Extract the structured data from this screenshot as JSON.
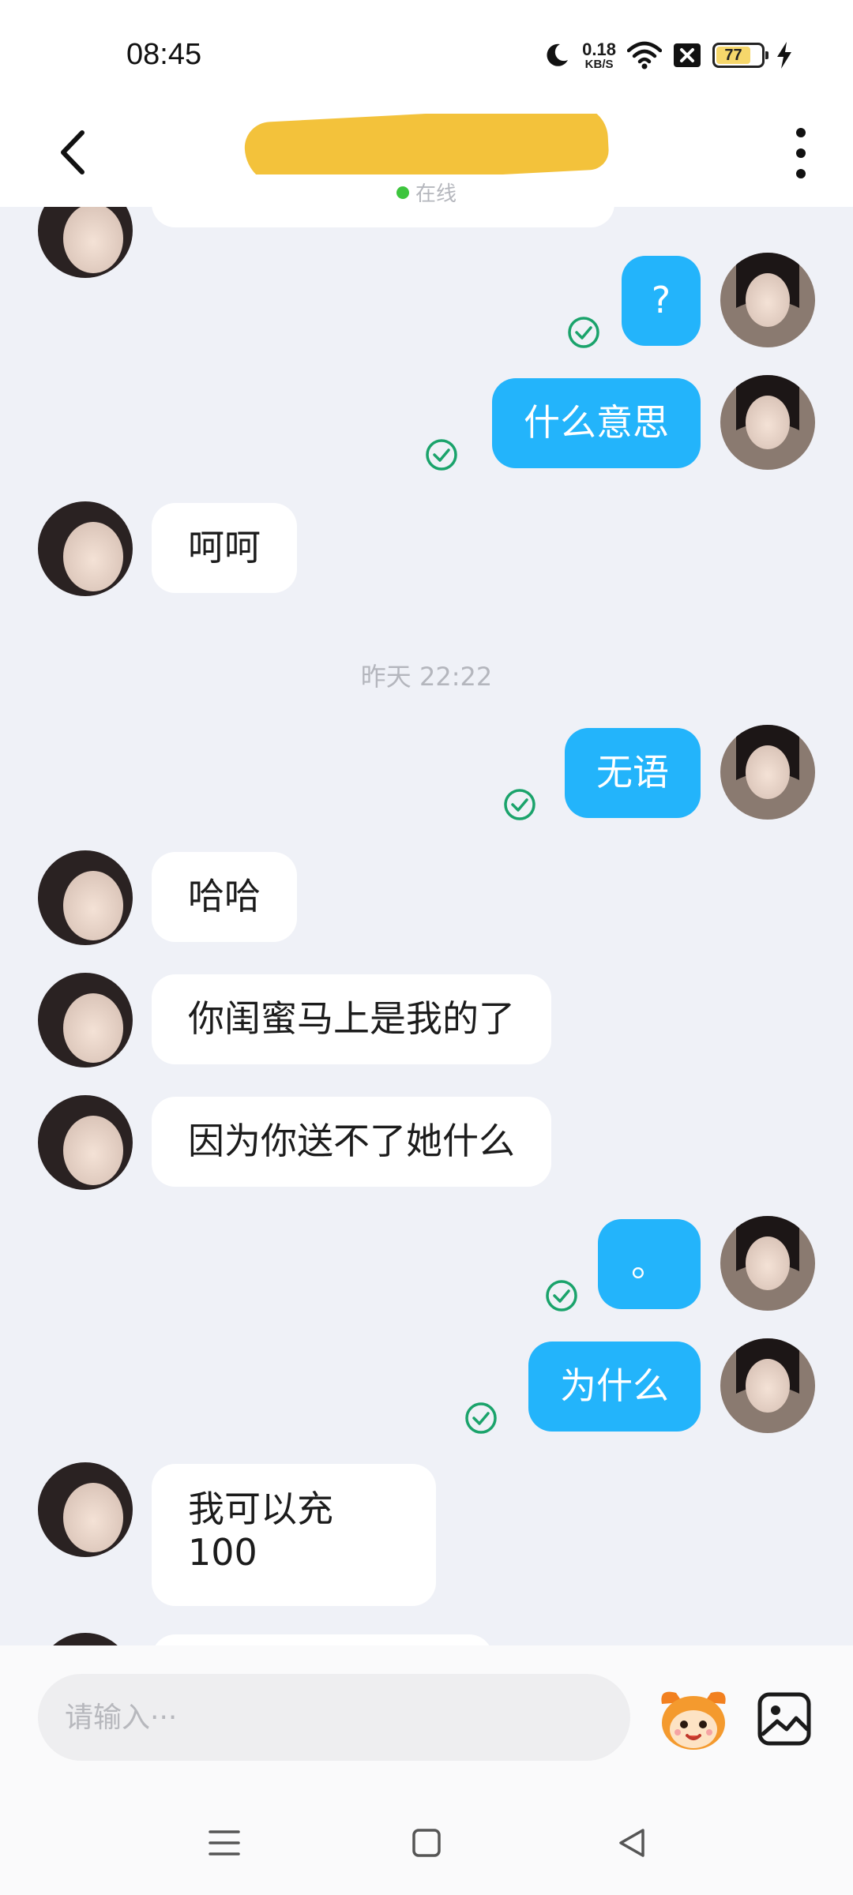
{
  "status_bar": {
    "time": "08:45",
    "net_speed_value": "0.18",
    "net_speed_unit": "KB/S",
    "battery_level": "77",
    "icons": [
      "moon-icon",
      "wifi-icon",
      "sim-off-icon",
      "battery-icon",
      "charging-icon"
    ]
  },
  "header": {
    "contact_name": "",
    "presence": "在线",
    "icons": [
      "back-arrow-icon",
      "more-vertical-icon"
    ]
  },
  "messages": [
    {
      "side": "out",
      "text": "?",
      "status": "read"
    },
    {
      "side": "out",
      "text": "什么意思",
      "status": "read"
    },
    {
      "side": "in",
      "text": "呵呵"
    },
    {
      "type": "timestamp",
      "text": "昨天 22:22"
    },
    {
      "side": "out",
      "text": "无语",
      "status": "read"
    },
    {
      "side": "in",
      "text": "哈哈"
    },
    {
      "side": "in",
      "text": "你闺蜜马上是我的了"
    },
    {
      "side": "in",
      "text": "因为你送不了她什么"
    },
    {
      "side": "out",
      "text": "。",
      "status": "read"
    },
    {
      "side": "out",
      "text": "为什么",
      "status": "read"
    },
    {
      "side": "in",
      "text": "我可以充100"
    }
  ],
  "input": {
    "placeholder": "请输入···"
  },
  "colors": {
    "outgoing_bubble": "#23b4fb",
    "incoming_bubble": "#ffffff",
    "chat_background": "#eff1f7",
    "read_check": "#1aa36b",
    "presence_dot": "#3dc53d"
  },
  "nav": {
    "icons": [
      "menu-icon",
      "home-square-icon",
      "back-triangle-icon"
    ]
  }
}
